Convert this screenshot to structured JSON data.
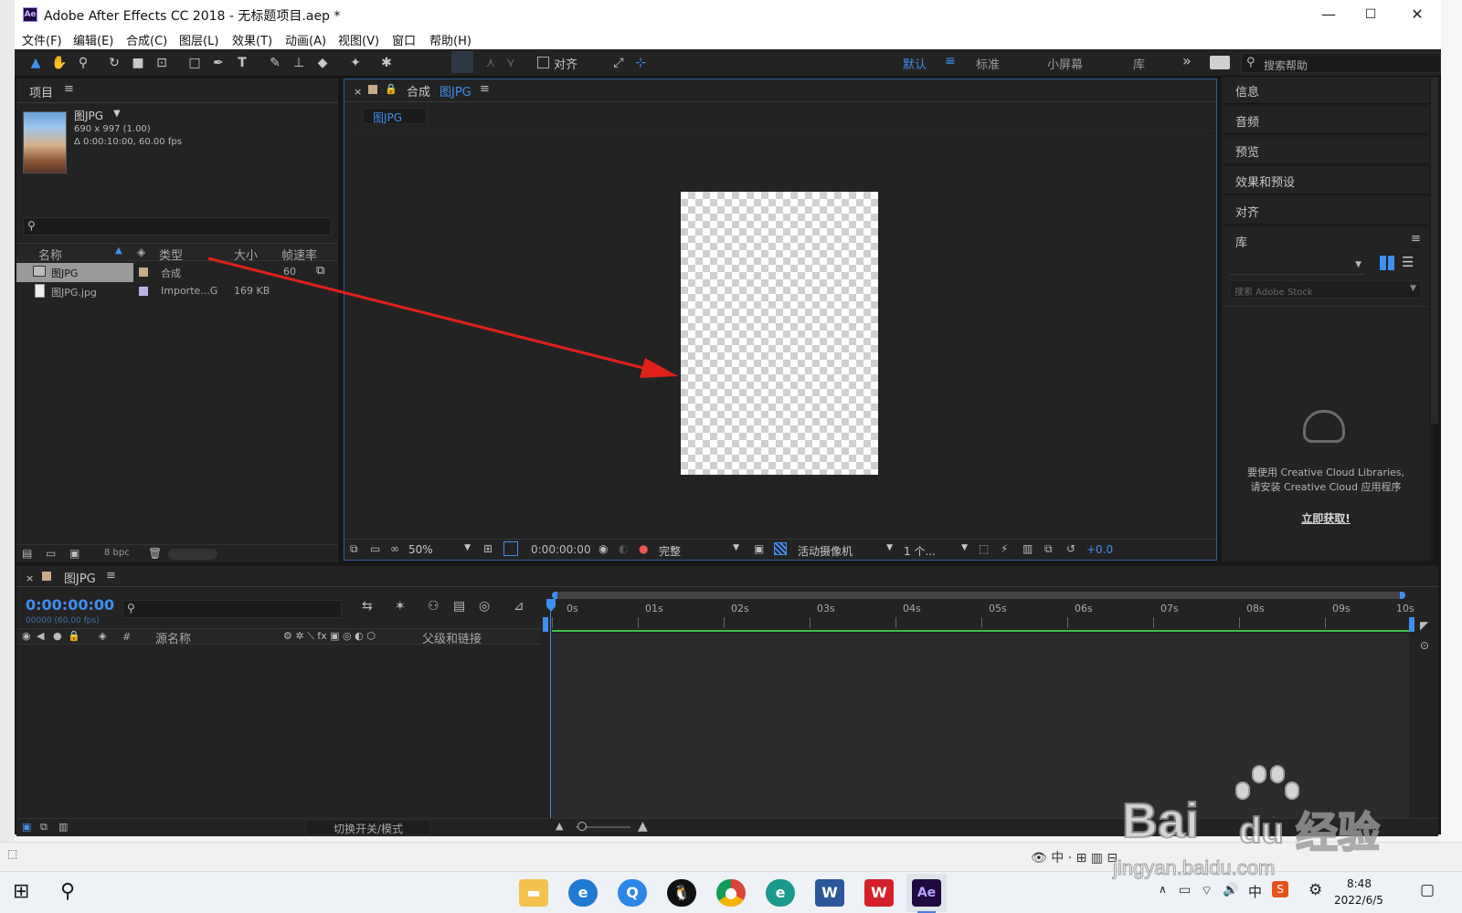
{
  "window": {
    "title": "Adobe After Effects CC 2018 - 无标题项目.aep *",
    "app_icon": "Ae",
    "min": "—",
    "max": "☐",
    "close": "✕"
  },
  "menu": [
    "文件(F)",
    "编辑(E)",
    "合成(C)",
    "图层(L)",
    "效果(T)",
    "动画(A)",
    "视图(V)",
    "窗口",
    "帮助(H)"
  ],
  "toolbar": {
    "align_label": "对齐",
    "workspaces": [
      "默认",
      "标准",
      "小屏幕",
      "库"
    ],
    "more": "»",
    "search_placeholder": "搜索帮助"
  },
  "project": {
    "title": "项目",
    "item_name": "图JPG",
    "item_dims": "690 x 997 (1.00)",
    "item_duration": "Δ 0:00:10:00, 60.00 fps",
    "search_placeholder": "",
    "columns": [
      "名称",
      "类型",
      "大小",
      "帧速率"
    ],
    "rows": [
      {
        "name": "图JPG",
        "type": "合成",
        "size": "",
        "fps": "60"
      },
      {
        "name": "图JPG.jpg",
        "type": "Importe...G",
        "size": "169 KB",
        "fps": ""
      }
    ],
    "bpc": "8 bpc"
  },
  "composition": {
    "tab_prefix": "合成",
    "tab_name": "图JPG",
    "flow_tab": "图JPG",
    "zoom": "50%",
    "timecode": "0:00:00:00",
    "resolution": "完整",
    "camera": "活动摄像机",
    "views": "1 个...",
    "exposure": "+0.0"
  },
  "right_panels": [
    "信息",
    "音频",
    "预览",
    "效果和预设",
    "对齐"
  ],
  "library": {
    "title": "库",
    "search_placeholder": "搜索 Adobe Stock",
    "message_line1": "要使用 Creative Cloud Libraries,",
    "message_line2": "请安装 Creative Cloud 应用程序",
    "link": "立即获取!"
  },
  "timeline": {
    "tab_name": "图JPG",
    "timecode": "0:00:00:00",
    "frames": "00000 (60.00 fps)",
    "col_hash": "#",
    "col_source": "源名称",
    "col_parent": "父级和链接",
    "ruler": [
      "0s",
      "01s",
      "02s",
      "03s",
      "04s",
      "05s",
      "06s",
      "07s",
      "08s",
      "09s",
      "10s"
    ],
    "toggle_label": "切换开关/模式"
  },
  "taskbar": {
    "time": "8:48",
    "date": "2022/6/5",
    "ime": "中"
  },
  "watermark": {
    "line1": "Bai",
    "line2": "du",
    "line3": "经验",
    "url": "jingyan.baidu.com"
  },
  "colors": {
    "accent": "#3f8ff0",
    "panel": "#232323",
    "arrow": "#e0201b",
    "green": "#3ec24a"
  }
}
